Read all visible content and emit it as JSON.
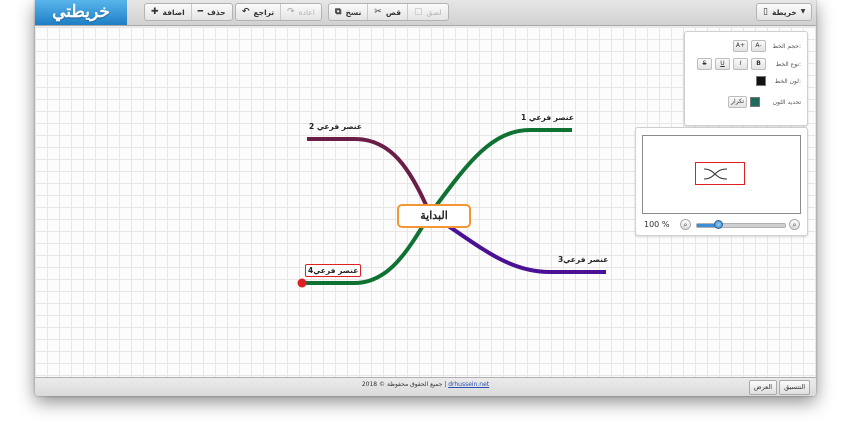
{
  "app": {
    "title": "خريطتي"
  },
  "toolbar": {
    "add_label": "اضافة",
    "delete_label": "حذف",
    "undo_label": "تراجع",
    "redo_label": "اعادة",
    "copy_label": "نسخ",
    "cut_label": "قص",
    "paste_label": "لصق",
    "map_menu_label": "خريطة"
  },
  "format_panel": {
    "font_size_label": "حجم الخط:",
    "font_size_buttons": [
      "A-",
      "A+"
    ],
    "font_style_label": "نوع الخط:",
    "font_style_buttons": [
      "B",
      "I",
      "U",
      "S"
    ],
    "font_color_label": "لون الخط:",
    "font_color": "#111111",
    "color_select_label": "تحديد اللون",
    "repeat_button": "تكرار",
    "branch_color": "#1e6b5e"
  },
  "mindmap": {
    "central_topic": "البداية",
    "central_border_color": "#f39733",
    "branches": [
      {
        "label": "عنصر فرعي 1",
        "color": "#0f7132"
      },
      {
        "label": "عنصر فرعي 2",
        "color": "#6a1e47"
      },
      {
        "label": "عنصر فرعي3",
        "color": "#4b1194"
      },
      {
        "label": "عنصر فرعي4",
        "color": "#0f7132",
        "selected": true
      }
    ]
  },
  "navigator": {
    "zoom_text": "100 %",
    "zoom_level_percent": 100,
    "slider_fraction": 0.25
  },
  "footer": {
    "copyright_text": "2018 © جميع الحقوق محفوظة |",
    "link_text": "drhussein.net",
    "layout_button": "التنسيق",
    "view_button": "العرض"
  }
}
